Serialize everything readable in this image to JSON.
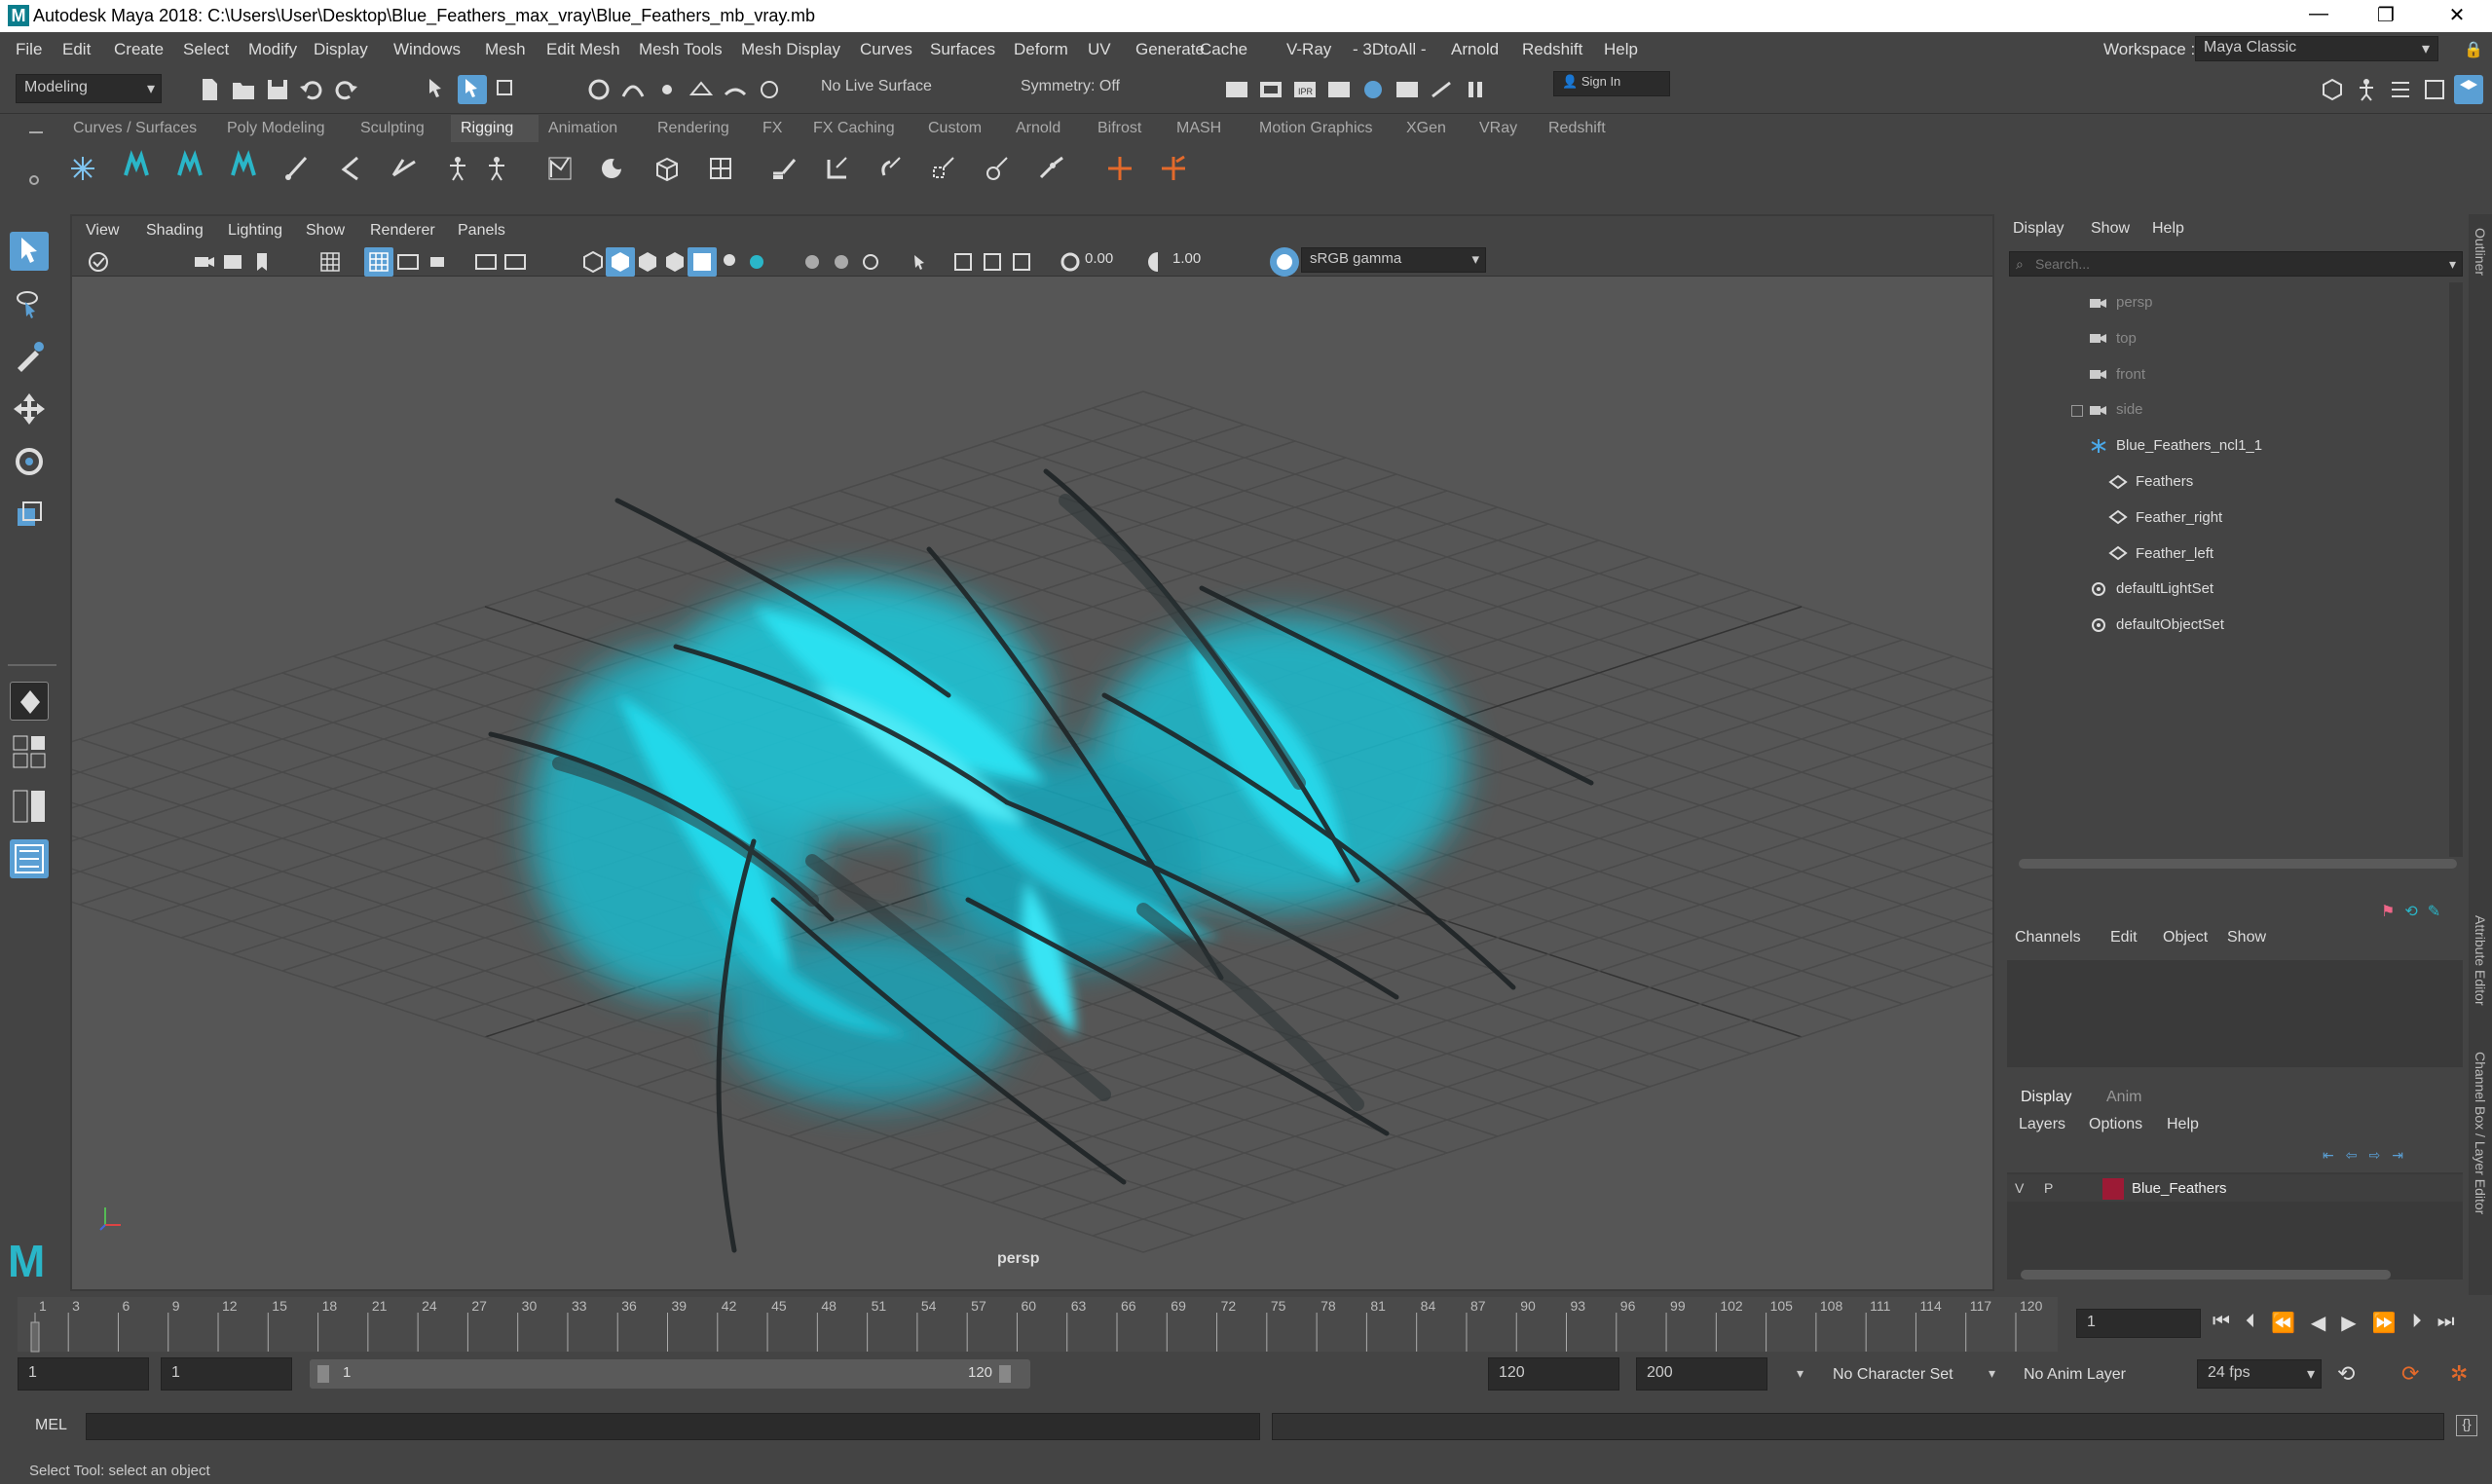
{
  "window": {
    "title": "Autodesk Maya 2018: C:\\Users\\User\\Desktop\\Blue_Feathers_max_vray\\Blue_Feathers_mb_vray.mb",
    "logo": "M"
  },
  "menu": [
    "File",
    "Edit",
    "Create",
    "Select",
    "Modify",
    "Display",
    "Windows",
    "Mesh",
    "Edit Mesh",
    "Mesh Tools",
    "Mesh Display",
    "Curves",
    "Surfaces",
    "Deform",
    "UV",
    "Generate",
    "Cache",
    "V-Ray",
    "- 3DtoAll -",
    "Arnold",
    "Redshift",
    "Help"
  ],
  "workspace": {
    "label": "Workspace :",
    "value": "Maya Classic"
  },
  "statusline": {
    "mode": "Modeling",
    "live_surface": "No Live Surface",
    "symmetry": "Symmetry: Off",
    "sign_in": "Sign In"
  },
  "shelf_tabs": [
    "Curves / Surfaces",
    "Poly Modeling",
    "Sculpting",
    "Rigging",
    "Animation",
    "Rendering",
    "FX",
    "FX Caching",
    "Custom",
    "Arnold",
    "Bifrost",
    "MASH",
    "Motion Graphics",
    "XGen",
    "VRay",
    "Redshift"
  ],
  "active_shelf_tab": "Rigging",
  "viewport": {
    "menu": [
      "View",
      "Shading",
      "Lighting",
      "Show",
      "Renderer",
      "Panels"
    ],
    "exposure": "0.00",
    "gamma": "1.00",
    "color_space": "sRGB gamma",
    "camera_label": "persp"
  },
  "outliner": {
    "menu": [
      "Display",
      "Show",
      "Help"
    ],
    "search_placeholder": "Search...",
    "items": [
      {
        "label": "persp",
        "icon": "camera-icon",
        "dim": true
      },
      {
        "label": "top",
        "icon": "camera-icon",
        "dim": true
      },
      {
        "label": "front",
        "icon": "camera-icon",
        "dim": true
      },
      {
        "label": "side",
        "icon": "camera-icon",
        "dim": true
      },
      {
        "label": "Blue_Feathers_ncl1_1",
        "icon": "group-icon",
        "dim": false
      },
      {
        "label": "Feathers",
        "icon": "mesh-icon",
        "dim": false
      },
      {
        "label": "Feather_right",
        "icon": "mesh-icon",
        "dim": false
      },
      {
        "label": "Feather_left",
        "icon": "mesh-icon",
        "dim": false
      },
      {
        "label": "defaultLightSet",
        "icon": "set-icon",
        "dim": false
      },
      {
        "label": "defaultObjectSet",
        "icon": "set-icon",
        "dim": false
      }
    ]
  },
  "channel_box": {
    "menu": [
      "Channels",
      "Edit",
      "Object",
      "Show"
    ],
    "layer_tabs": [
      "Display",
      "Anim"
    ],
    "layer_menu": [
      "Layers",
      "Options",
      "Help"
    ],
    "layer": {
      "v": "V",
      "p": "P",
      "name": "Blue_Feathers",
      "color": "#9c1a35"
    }
  },
  "side_tabs": [
    "Outliner",
    "Attribute Editor",
    "Channel Box / Layer Editor"
  ],
  "timeline": {
    "ticks": [
      "1",
      "3",
      "6",
      "9",
      "12",
      "15",
      "18",
      "21",
      "24",
      "27",
      "30",
      "33",
      "36",
      "39",
      "42",
      "45",
      "48",
      "51",
      "54",
      "57",
      "60",
      "63",
      "66",
      "69",
      "72",
      "75",
      "78",
      "81",
      "84",
      "87",
      "90",
      "93",
      "96",
      "99",
      "102",
      "105",
      "108",
      "111",
      "114",
      "117",
      "120"
    ],
    "current_frame": "1"
  },
  "range": {
    "start": "1",
    "inner_start": "1",
    "slider_start": "1",
    "slider_end": "120",
    "end": "120",
    "anim_end": "200",
    "character_set": "No Character Set",
    "anim_layer": "No Anim Layer",
    "fps": "24 fps"
  },
  "command": {
    "label": "MEL"
  },
  "status": "Select Tool: select an object",
  "colors": {
    "feather": "#22d4e8",
    "accent": "#5a9fd4"
  }
}
